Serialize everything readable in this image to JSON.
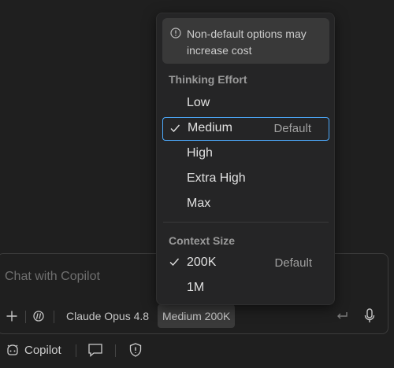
{
  "chat": {
    "placeholder": "Chat with Copilot",
    "model_label": "Claude Opus 4.8",
    "mode_label": "Medium 200K"
  },
  "status_bar": {
    "copilot_label": "Copilot"
  },
  "menu": {
    "notice": "Non-default options may increase cost",
    "thinking_effort": {
      "header": "Thinking Effort",
      "items": [
        {
          "label": "Low",
          "selected": false,
          "default": ""
        },
        {
          "label": "Medium",
          "selected": true,
          "default": "Default"
        },
        {
          "label": "High",
          "selected": false,
          "default": ""
        },
        {
          "label": "Extra High",
          "selected": false,
          "default": ""
        },
        {
          "label": "Max",
          "selected": false,
          "default": ""
        }
      ]
    },
    "context_size": {
      "header": "Context Size",
      "items": [
        {
          "label": "200K",
          "selected": true,
          "default": "Default"
        },
        {
          "label": "1M",
          "selected": false,
          "default": ""
        }
      ]
    }
  },
  "colors": {
    "background": "#1f1f1f",
    "menu_background": "#252526",
    "focus_border": "#4daafc",
    "notice_background": "#393939"
  }
}
